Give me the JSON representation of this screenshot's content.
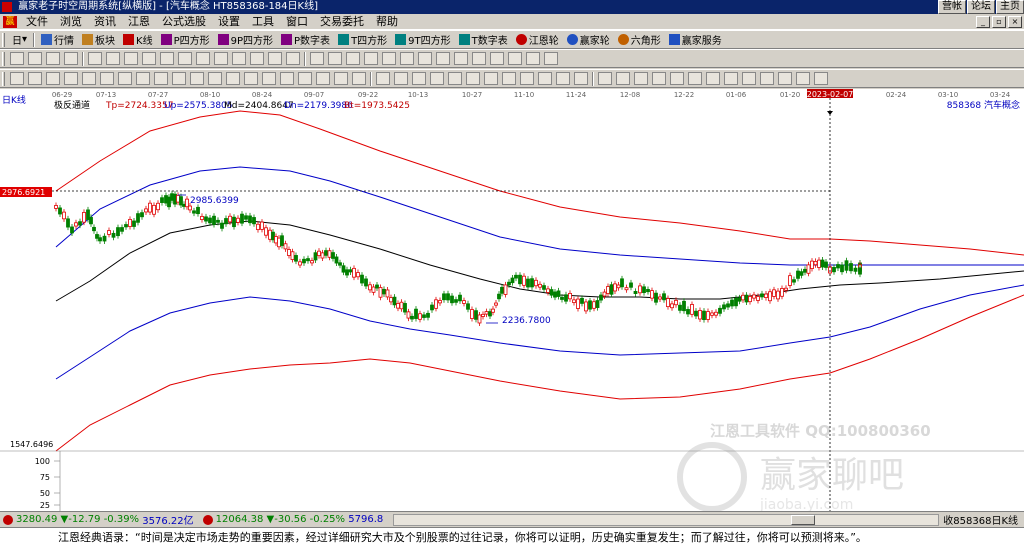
{
  "window": {
    "title": "赢家老子时空周期系统[纵横版] - [汽车概念  HT858368-184日K线]",
    "links": [
      "营帐",
      "论坛",
      "主页"
    ]
  },
  "menu": {
    "items": [
      "文件",
      "浏览",
      "资讯",
      "江恩",
      "公式选股",
      "设置",
      "工具",
      "窗口",
      "交易委托",
      "帮助"
    ]
  },
  "toolbar1": {
    "items": [
      "日",
      "行情",
      "板块",
      "K线",
      "P四方形",
      "9P四方形",
      "P数字表",
      "T四方形",
      "9T四方形",
      "T数字表",
      "江恩轮",
      "赢家轮",
      "六角形",
      "赢家服务"
    ]
  },
  "chart": {
    "period_label": "日K线",
    "indicator_name": "极反通道",
    "tp": "Tp=2724.3357",
    "up": "Up=2575.3805",
    "md": "Md=2404.8647",
    "dn": "Dn=2179.3986",
    "bt": "Bt=1973.5425",
    "code_name": "858368 汽车概念",
    "price_box": "2976.6921",
    "low_price_label": "1547.6496",
    "high_label": "2985.6399",
    "low_label": "2236.7800",
    "crosshair_date": "2023-02-07",
    "date_ticks": [
      "06-29",
      "07-13",
      "07-27",
      "08-10",
      "08-24",
      "09-07",
      "09-22",
      "10-13",
      "10-27",
      "11-10",
      "11-24",
      "12-08",
      "12-22",
      "01-06",
      "01-20",
      "02-24",
      "03-10",
      "03-24"
    ],
    "osc_ticks": [
      "100",
      "75",
      "50",
      "25"
    ],
    "watermark_line1": "江恩工具软件  QQ:100800360",
    "watermark_line2": "赢家聊吧",
    "watermark_line3": "jiaoba.yi.com",
    "colors": {
      "up": "#e00000",
      "down": "#008000",
      "upper": "#e00000",
      "mid": "#0000c8",
      "center": "#000000"
    }
  },
  "status": {
    "idx1": "3280.49",
    "idx1_chg": "-12.79",
    "idx1_pct": "-0.39%",
    "idx1_vol": "3576.22亿",
    "idx2": "12064.38",
    "idx2_chg": "-30.56",
    "idx2_pct": "-0.25%",
    "idx2_vol": "5796.8",
    "right": "收858368日K线"
  },
  "quote": "江恩经典语录：“时间是决定市场走势的重要因素，经过详细研究大市及个别股票的过往记录，你将可以证明，历史确实重复发生；而了解过往，你将可以预测将来。”。"
}
